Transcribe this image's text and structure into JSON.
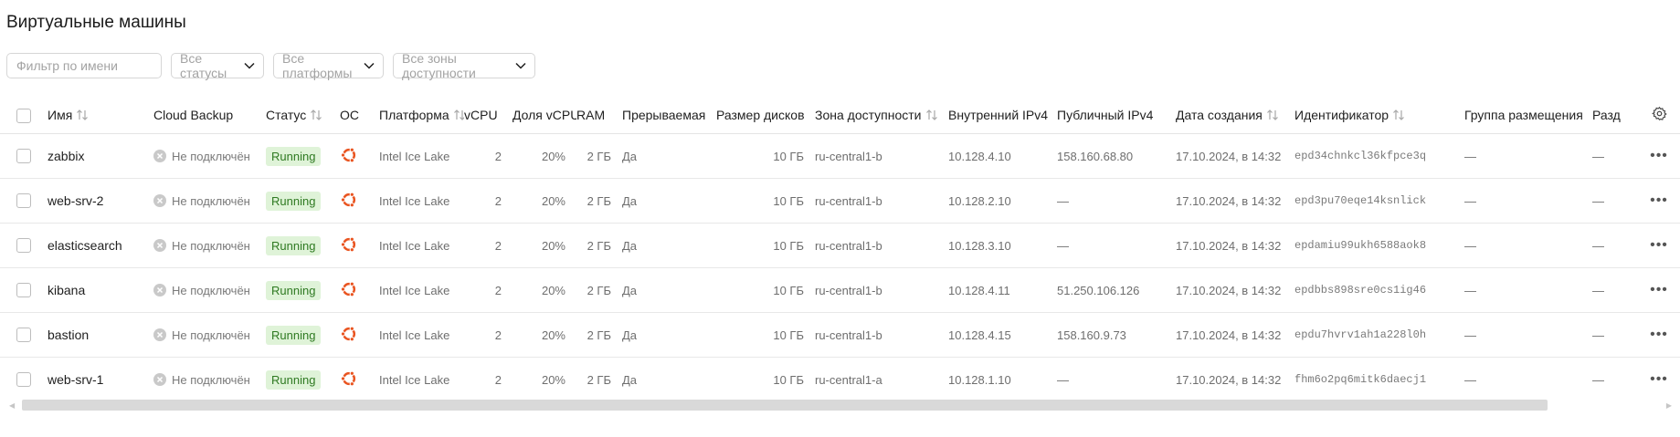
{
  "page": {
    "title": "Виртуальные машины"
  },
  "filters": {
    "name_placeholder": "Фильтр по имени",
    "status": "Все статусы",
    "platform": "Все платформы",
    "zone": "Все зоны доступности"
  },
  "table": {
    "headers": {
      "name": "Имя",
      "backup": "Cloud Backup",
      "status": "Статус",
      "os": "ОС",
      "platform": "Платформа",
      "vcpu": "vCPU",
      "vcpu_share": "Доля vCPU",
      "ram": "RAM",
      "preemptible": "Прерываемая",
      "disk_size": "Размер дисков",
      "zone": "Зона доступности",
      "internal_ip": "Внутренний IPv4",
      "public_ip": "Публичный IPv4",
      "created": "Дата создания",
      "id": "Идентификатор",
      "placement_group": "Группа размещения",
      "partition": "Разд"
    },
    "rows": [
      {
        "name": "zabbix",
        "backup": "Не подключён",
        "status": "Running",
        "os_icon": "ubuntu-icon",
        "platform": "Intel Ice Lake",
        "vcpu": "2",
        "vcpu_share": "20%",
        "ram": "2 ГБ",
        "preemptible": "Да",
        "disk_size": "10 ГБ",
        "zone": "ru-central1-b",
        "internal_ip": "10.128.4.10",
        "public_ip": "158.160.68.80",
        "created": "17.10.2024, в 14:32",
        "id": "epd34chnkcl36kfpce3q",
        "placement_group": "—",
        "partition": "—"
      },
      {
        "name": "web-srv-2",
        "backup": "Не подключён",
        "status": "Running",
        "os_icon": "ubuntu-icon",
        "platform": "Intel Ice Lake",
        "vcpu": "2",
        "vcpu_share": "20%",
        "ram": "2 ГБ",
        "preemptible": "Да",
        "disk_size": "10 ГБ",
        "zone": "ru-central1-b",
        "internal_ip": "10.128.2.10",
        "public_ip": "—",
        "created": "17.10.2024, в 14:32",
        "id": "epd3pu70eqe14ksnlick",
        "placement_group": "—",
        "partition": "—"
      },
      {
        "name": "elasticsearch",
        "backup": "Не подключён",
        "status": "Running",
        "os_icon": "ubuntu-icon",
        "platform": "Intel Ice Lake",
        "vcpu": "2",
        "vcpu_share": "20%",
        "ram": "2 ГБ",
        "preemptible": "Да",
        "disk_size": "10 ГБ",
        "zone": "ru-central1-b",
        "internal_ip": "10.128.3.10",
        "public_ip": "—",
        "created": "17.10.2024, в 14:32",
        "id": "epdamiu99ukh6588aok8",
        "placement_group": "—",
        "partition": "—"
      },
      {
        "name": "kibana",
        "backup": "Не подключён",
        "status": "Running",
        "os_icon": "ubuntu-icon",
        "platform": "Intel Ice Lake",
        "vcpu": "2",
        "vcpu_share": "20%",
        "ram": "2 ГБ",
        "preemptible": "Да",
        "disk_size": "10 ГБ",
        "zone": "ru-central1-b",
        "internal_ip": "10.128.4.11",
        "public_ip": "51.250.106.126",
        "created": "17.10.2024, в 14:32",
        "id": "epdbbs898sre0cs1ig46",
        "placement_group": "—",
        "partition": "—"
      },
      {
        "name": "bastion",
        "backup": "Не подключён",
        "status": "Running",
        "os_icon": "ubuntu-icon",
        "platform": "Intel Ice Lake",
        "vcpu": "2",
        "vcpu_share": "20%",
        "ram": "2 ГБ",
        "preemptible": "Да",
        "disk_size": "10 ГБ",
        "zone": "ru-central1-b",
        "internal_ip": "10.128.4.15",
        "public_ip": "158.160.9.73",
        "created": "17.10.2024, в 14:32",
        "id": "epdu7hvrv1ah1a228l0h",
        "placement_group": "—",
        "partition": "—"
      },
      {
        "name": "web-srv-1",
        "backup": "Не подключён",
        "status": "Running",
        "os_icon": "ubuntu-icon",
        "platform": "Intel Ice Lake",
        "vcpu": "2",
        "vcpu_share": "20%",
        "ram": "2 ГБ",
        "preemptible": "Да",
        "disk_size": "10 ГБ",
        "zone": "ru-central1-a",
        "internal_ip": "10.128.1.10",
        "public_ip": "—",
        "created": "17.10.2024, в 14:32",
        "id": "fhm6o2pq6mitk6daecj1",
        "placement_group": "—",
        "partition": "—"
      }
    ]
  },
  "colors": {
    "running_bg": "#dff3d8",
    "running_text": "#2f7a22",
    "ubuntu": "#e95420"
  },
  "icons": {
    "sort": "sort-icon",
    "settings": "gear-icon",
    "more": "more-icon",
    "backup_off": "x-circle-icon",
    "chevron": "chevron-down-icon"
  }
}
